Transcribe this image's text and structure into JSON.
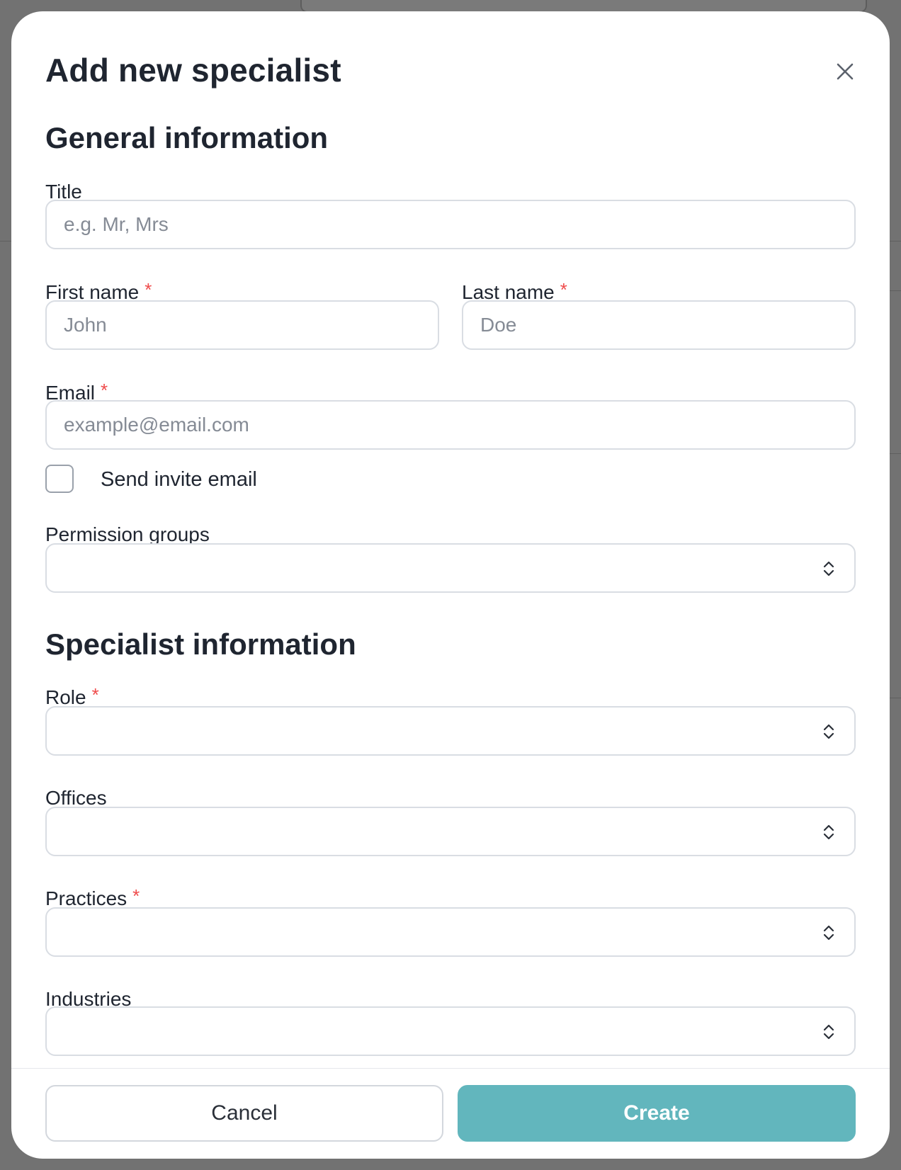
{
  "modal": {
    "title": "Add new specialist",
    "close_icon": "close-icon"
  },
  "general": {
    "heading": "General information",
    "title_label": "Title",
    "title_placeholder": "e.g. Mr, Mrs",
    "first_name_label": "First name",
    "first_name_placeholder": "John",
    "last_name_label": "Last name",
    "last_name_placeholder": "Doe",
    "email_label": "Email",
    "email_placeholder": "example@email.com",
    "send_invite_label": "Send invite email",
    "permission_groups_label": "Permission groups",
    "required_marker": "*"
  },
  "specialist": {
    "heading": "Specialist information",
    "role_label": "Role",
    "offices_label": "Offices",
    "practices_label": "Practices",
    "industries_label": "Industries"
  },
  "footer": {
    "cancel_label": "Cancel",
    "create_label": "Create"
  },
  "colors": {
    "primary": "#62b6bd",
    "required": "#ef4b4b",
    "text": "#1f2530",
    "border": "#d9dde3"
  }
}
